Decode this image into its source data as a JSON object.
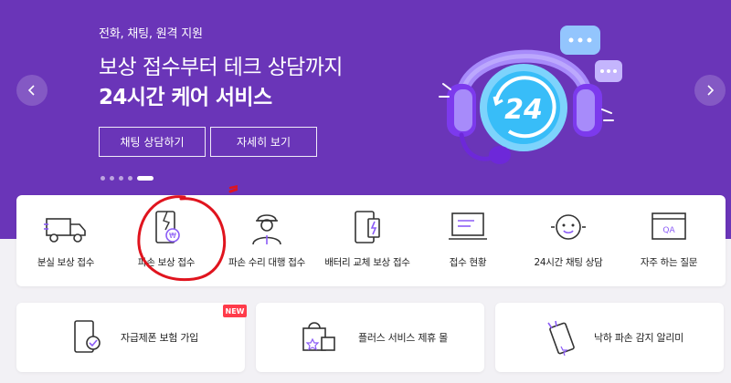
{
  "hero": {
    "subtitle": "전화, 채팅, 원격 지원",
    "title_line1": "보상 접수부터 테크 상담까지",
    "title_line2": "24시간 케어 서비스",
    "btn_chat": "채팅 상담하기",
    "btn_more": "자세히 보기",
    "slide_count": 5,
    "active_slide": 5,
    "illustration_text": "24",
    "colors": {
      "background": "#6a35b8",
      "accent": "#8b5cf6"
    }
  },
  "services": [
    {
      "label": "분실 보상 접수",
      "icon": "truck-icon"
    },
    {
      "label": "파손 보상 접수",
      "icon": "broken-phone-won-icon"
    },
    {
      "label": "파손 수리 대행 접수",
      "icon": "technician-icon"
    },
    {
      "label": "배터리 교체 보상 접수",
      "icon": "battery-phone-icon"
    },
    {
      "label": "접수 현황",
      "icon": "monitor-icon"
    },
    {
      "label": "24시간 채팅 상담",
      "icon": "chat-bot-icon"
    },
    {
      "label": "자주 하는 질문",
      "icon": "qa-window-icon"
    }
  ],
  "promos": [
    {
      "label": "자급제폰 보험 가입",
      "icon": "phone-insurance-icon",
      "badge": "NEW"
    },
    {
      "label": "플러스 서비스 제휴 몰",
      "icon": "shopping-bag-icon"
    },
    {
      "label": "낙하 파손 감지 알리미",
      "icon": "drop-alert-icon"
    }
  ],
  "annotation": {
    "color": "#e0141e"
  }
}
